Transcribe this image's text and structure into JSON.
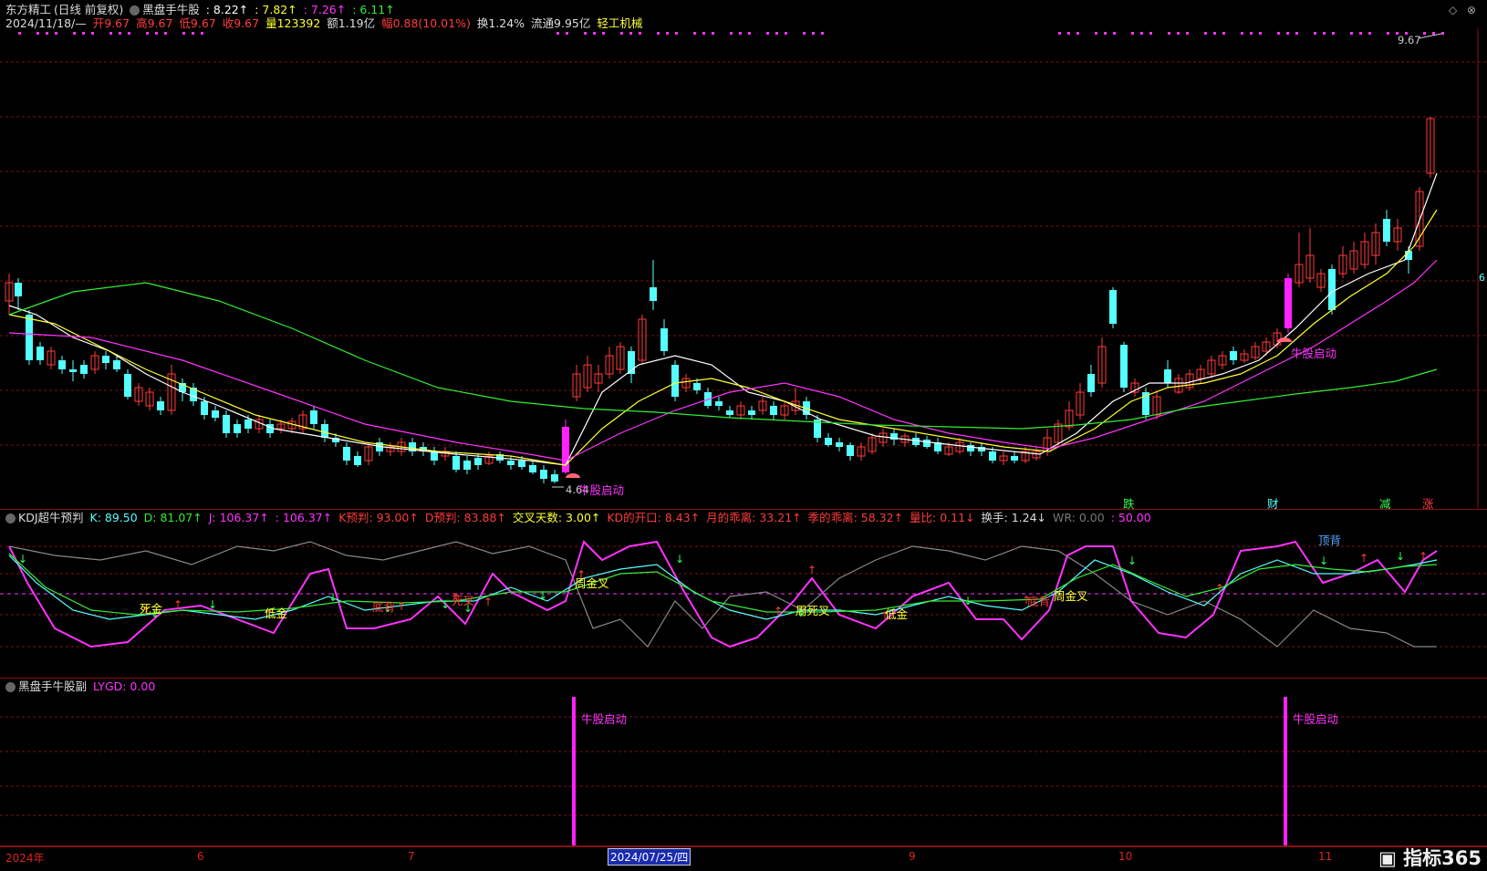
{
  "main": {
    "title_prefix": "东方精工",
    "title_mode": "(日线 前复权)",
    "indicator_name": "黑盘手牛股",
    "ma_values": [
      ": 8.22↑",
      ": 7.82↑",
      ": 7.26↑",
      ": 6.11↑"
    ],
    "date": "2024/11/18/—",
    "open": "开9.67",
    "high": "高9.67",
    "low": "低9.67",
    "close": "收9.67",
    "volume": "量123392",
    "amount": "额1.19亿",
    "change": "幅0.88(10.01%)",
    "turnover": "换1.24%",
    "float": "流通9.95亿",
    "industry": "轻工机械",
    "high_price_label": "9.67",
    "low_price_label": "4.64",
    "signal_labels": [
      "牛股启动",
      "牛股启动"
    ],
    "bottom_markers": [
      "跌",
      "财",
      "减",
      "涨"
    ],
    "right_edge_value": "6",
    "colors": {
      "up": "#ff3b3b",
      "down": "#54ffff",
      "ma5": "#ffffff",
      "ma10": "#ffff33",
      "ma20": "#ff33ff",
      "ma60": "#33ee33",
      "magenta": "#ff22ff"
    }
  },
  "kdj": {
    "name": "KDJ超牛预判",
    "k": "K: 89.50",
    "d": "D: 81.07↑",
    "j": "J: 106.37↑",
    "j2": ": 106.37↑",
    "k_pred": "K预判: 93.00↑",
    "d_pred": "D预判: 83.88↑",
    "cross_days": "交叉天数: 3.00↑",
    "kd_gap": "KD的开口: 8.43↑",
    "month_dev": "月的乖离: 33.21↑",
    "season_dev": "季的乖离: 58.32↑",
    "vol_ratio": "量比: 0.11↓",
    "turnover": "换手: 1.24↓",
    "wr": "WR: 0.00",
    "wr2": ": 50.00",
    "labels": [
      "死金",
      "低金",
      "底背",
      "死叉",
      "周金叉",
      "周死叉",
      "低金",
      "底背",
      "周金叉",
      "顶背"
    ]
  },
  "sub": {
    "name": "黑盘手牛股副",
    "lygd": "LYGD: 0.00",
    "signal_labels": [
      "牛股启动",
      "牛股启动"
    ]
  },
  "xaxis": {
    "ticks": [
      "2024年",
      "6",
      "7",
      "9",
      "10",
      "11"
    ],
    "selected_date": "2024/07/25/四",
    "logo": "指标365"
  }
}
